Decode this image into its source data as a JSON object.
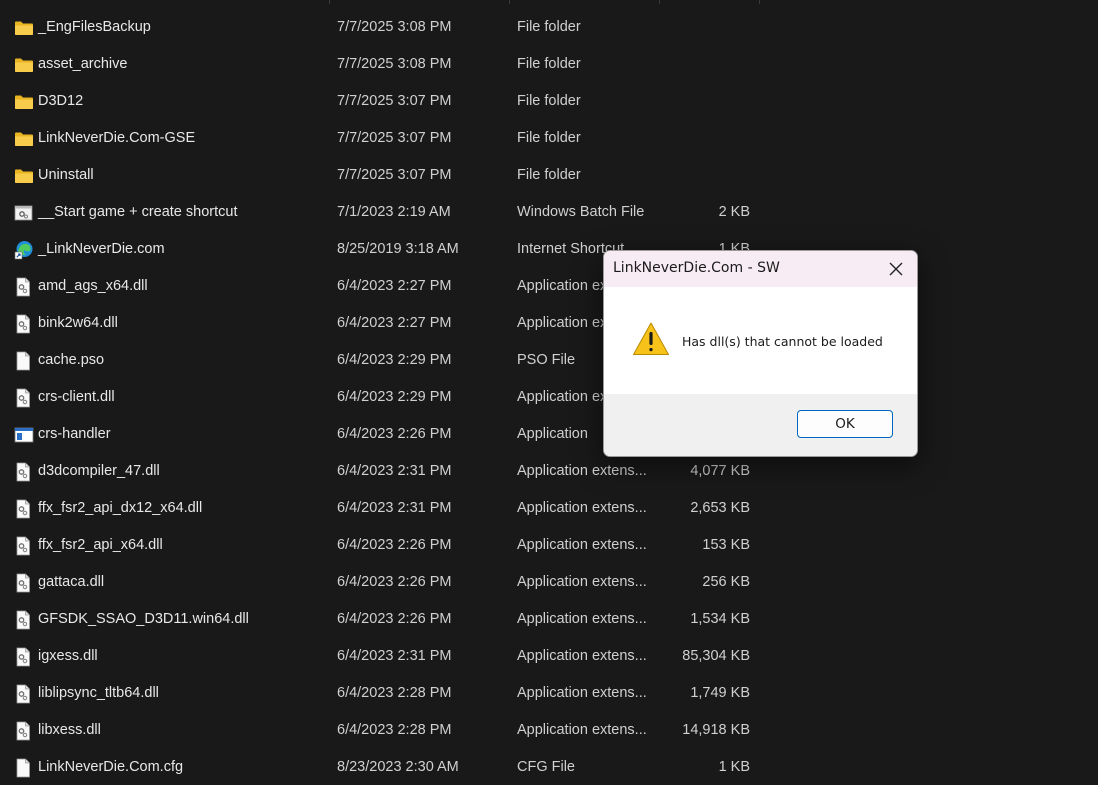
{
  "files": [
    {
      "name": "_EngFilesBackup",
      "date": "7/7/2025 3:08 PM",
      "type": "File folder",
      "size": "",
      "icon": "folder-icon"
    },
    {
      "name": "asset_archive",
      "date": "7/7/2025 3:08 PM",
      "type": "File folder",
      "size": "",
      "icon": "folder-icon"
    },
    {
      "name": "D3D12",
      "date": "7/7/2025 3:07 PM",
      "type": "File folder",
      "size": "",
      "icon": "folder-icon"
    },
    {
      "name": "LinkNeverDie.Com-GSE",
      "date": "7/7/2025 3:07 PM",
      "type": "File folder",
      "size": "",
      "icon": "folder-icon"
    },
    {
      "name": "Uninstall",
      "date": "7/7/2025 3:07 PM",
      "type": "File folder",
      "size": "",
      "icon": "folder-icon"
    },
    {
      "name": "__Start game + create shortcut",
      "date": "7/1/2023 2:19 AM",
      "type": "Windows Batch File",
      "size": "2 KB",
      "icon": "batch-file-icon"
    },
    {
      "name": "_LinkNeverDie.com",
      "date": "8/25/2019 3:18 AM",
      "type": "Internet Shortcut",
      "size": "1 KB",
      "icon": "edge-shortcut-icon"
    },
    {
      "name": "amd_ags_x64.dll",
      "date": "6/4/2023 2:27 PM",
      "type": "Application extens...",
      "size": "",
      "icon": "dll-file-icon"
    },
    {
      "name": "bink2w64.dll",
      "date": "6/4/2023 2:27 PM",
      "type": "Application extens...",
      "size": "",
      "icon": "dll-file-icon"
    },
    {
      "name": "cache.pso",
      "date": "6/4/2023 2:29 PM",
      "type": "PSO File",
      "size": "",
      "icon": "blank-file-icon"
    },
    {
      "name": "crs-client.dll",
      "date": "6/4/2023 2:29 PM",
      "type": "Application extens...",
      "size": "",
      "icon": "dll-file-icon"
    },
    {
      "name": "crs-handler",
      "date": "6/4/2023 2:26 PM",
      "type": "Application",
      "size": "",
      "icon": "application-icon"
    },
    {
      "name": "d3dcompiler_47.dll",
      "date": "6/4/2023 2:31 PM",
      "type": "Application extens...",
      "size": "4,077 KB",
      "icon": "dll-file-icon"
    },
    {
      "name": "ffx_fsr2_api_dx12_x64.dll",
      "date": "6/4/2023 2:31 PM",
      "type": "Application extens...",
      "size": "2,653 KB",
      "icon": "dll-file-icon"
    },
    {
      "name": "ffx_fsr2_api_x64.dll",
      "date": "6/4/2023 2:26 PM",
      "type": "Application extens...",
      "size": "153 KB",
      "icon": "dll-file-icon"
    },
    {
      "name": "gattaca.dll",
      "date": "6/4/2023 2:26 PM",
      "type": "Application extens...",
      "size": "256 KB",
      "icon": "dll-file-icon"
    },
    {
      "name": "GFSDK_SSAO_D3D11.win64.dll",
      "date": "6/4/2023 2:26 PM",
      "type": "Application extens...",
      "size": "1,534 KB",
      "icon": "dll-file-icon"
    },
    {
      "name": "igxess.dll",
      "date": "6/4/2023 2:31 PM",
      "type": "Application extens...",
      "size": "85,304 KB",
      "icon": "dll-file-icon"
    },
    {
      "name": "liblipsync_tltb64.dll",
      "date": "6/4/2023 2:28 PM",
      "type": "Application extens...",
      "size": "1,749 KB",
      "icon": "dll-file-icon"
    },
    {
      "name": "libxess.dll",
      "date": "6/4/2023 2:28 PM",
      "type": "Application extens...",
      "size": "14,918 KB",
      "icon": "dll-file-icon"
    },
    {
      "name": "LinkNeverDie.Com.cfg",
      "date": "8/23/2023 2:30 AM",
      "type": "CFG File",
      "size": "1 KB",
      "icon": "blank-file-icon"
    }
  ],
  "dialog": {
    "title": "LinkNeverDie.Com - SW",
    "message": "Has dll(s) that cannot be loaded",
    "ok_label": "OK",
    "icon": "warning-icon",
    "close_icon": "close-icon"
  },
  "colors": {
    "background": "#191919",
    "folder": "#f4c542",
    "warning": "#f7c31a",
    "accent": "#0067c0"
  }
}
